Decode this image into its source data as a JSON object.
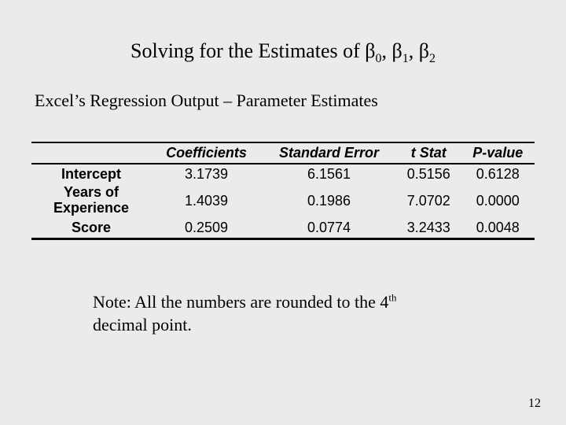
{
  "title": {
    "pre": "Solving for the Estimates of ",
    "beta": "β",
    "s0": "0",
    "sep": ", ",
    "s1": "1",
    "s2": "2"
  },
  "subtitle": "Excel’s Regression Output – Parameter Estimates",
  "chart_data": {
    "type": "table",
    "title": "Parameter Estimates",
    "columns": [
      "",
      "Coefficients",
      "Standard Error",
      "t Stat",
      "P-value"
    ],
    "rows": [
      {
        "label": "Intercept",
        "coef": "3.1739",
        "se": "6.1561",
        "t": "0.5156",
        "p": "0.6128"
      },
      {
        "label": "Years of Experience",
        "coef": "1.4039",
        "se": "0.1986",
        "t": "7.0702",
        "p": "0.0000"
      },
      {
        "label": "Score",
        "coef": "0.2509",
        "se": "0.0774",
        "t": "3.2433",
        "p": "0.0048"
      }
    ]
  },
  "note": {
    "pre": "Note: All the numbers are rounded to the 4",
    "sup": "th",
    "post": " decimal point."
  },
  "page_number": "12"
}
